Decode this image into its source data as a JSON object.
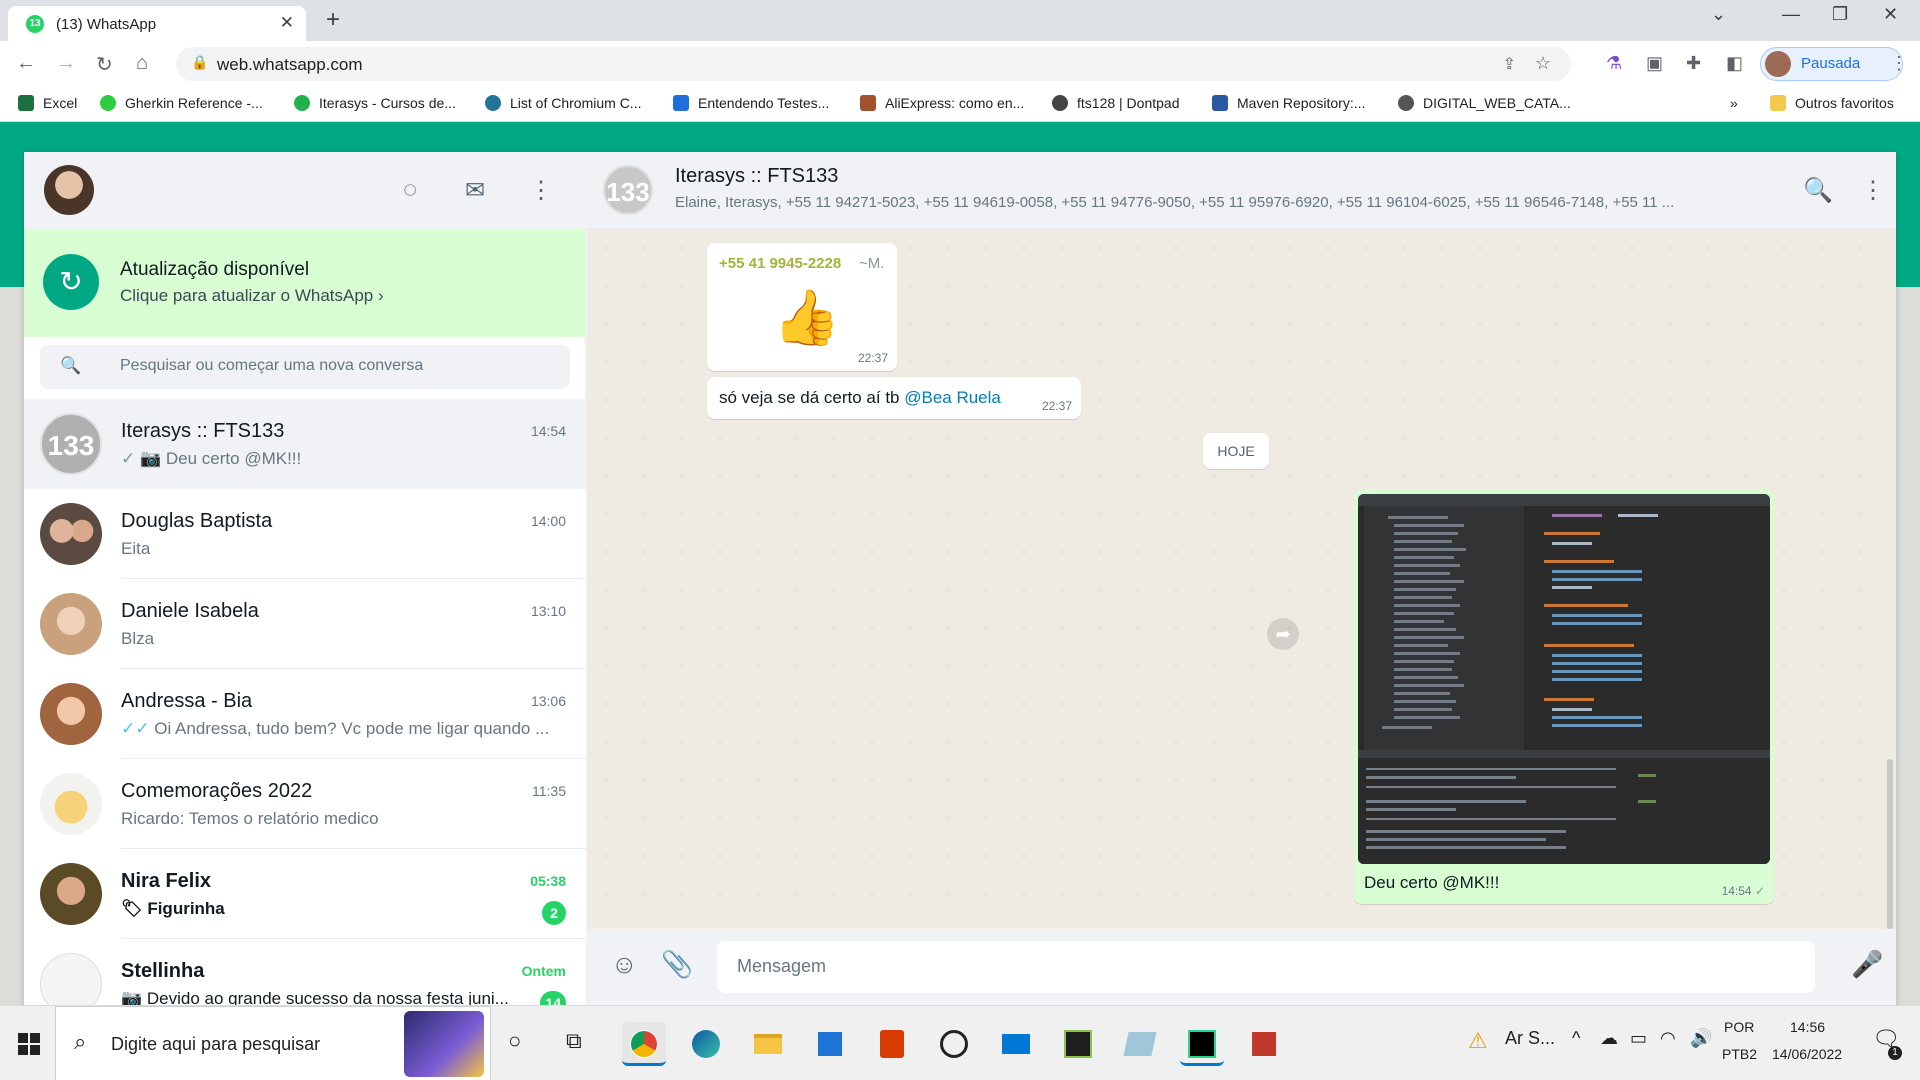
{
  "browser": {
    "tab_title": "(13) WhatsApp",
    "tab_badge": "13",
    "url": "web.whatsapp.com",
    "profile_label": "Pausada",
    "bookmarks": [
      {
        "label": "Excel",
        "color": "#1d6f42"
      },
      {
        "label": "Gherkin Reference -...",
        "color": "#2ecc40"
      },
      {
        "label": "Iterasys - Cursos de...",
        "color": "#22b14c"
      },
      {
        "label": "List of Chromium C...",
        "color": "#21759b"
      },
      {
        "label": "Entendendo Testes...",
        "color": "#1e6fd9"
      },
      {
        "label": "AliExpress: como en...",
        "color": "#a0522d"
      },
      {
        "label": "fts128 | Dontpad",
        "color": "#444444"
      },
      {
        "label": "Maven Repository:...",
        "color": "#2c5aa0"
      },
      {
        "label": "DIGITAL_WEB_CATA...",
        "color": "#555555"
      }
    ],
    "more_bookmarks": "»",
    "other_favorites": "Outros favoritos"
  },
  "update_banner": {
    "title": "Atualização disponível",
    "subtitle": "Clique para atualizar o WhatsApp"
  },
  "search": {
    "placeholder": "Pesquisar ou começar uma nova conversa"
  },
  "chats": [
    {
      "name": "Iterasys :: FTS133",
      "time": "14:54",
      "tick": "✓",
      "tick_color": "grey",
      "msg": "Deu certo @MK!!!",
      "media": "📷",
      "avatar_text": "133",
      "avatar_color": "#b0b0b0",
      "selected": true
    },
    {
      "name": "Douglas Baptista",
      "time": "14:00",
      "msg": "Eita",
      "avatar_color": "#5a4a42"
    },
    {
      "name": "Daniele Isabela",
      "time": "13:10",
      "msg": "Blza",
      "avatar_color": "#d7b9a0"
    },
    {
      "name": "Andressa - Bia",
      "time": "13:06",
      "tick": "✓✓",
      "tick_color": "blue",
      "msg": "Oi Andressa, tudo bem? Vc pode me ligar quando ...",
      "avatar_color": "#c98a6a"
    },
    {
      "name": "Comemorações 2022",
      "time": "11:35",
      "msg": "Ricardo: Temos o relatório medico",
      "avatar_color": "#e8c47a"
    },
    {
      "name": "Nira Felix",
      "time": "05:38",
      "time_green": true,
      "media": "🏷",
      "msg": "Figurinha",
      "badge": "2",
      "avatar_color": "#6b5a3a"
    },
    {
      "name": "Stellinha",
      "time": "Ontem",
      "time_green": true,
      "media": "📷",
      "msg": "Devido ao grande sucesso da nossa festa juni...",
      "badge": "14",
      "avatar_color": "#f4f4f4"
    }
  ],
  "conversation": {
    "name": "Iterasys :: FTS133",
    "avatar_text": "133",
    "members": "Elaine, Iterasys, +55 11 94271-5023, +55 11 94619-0058, +55 11 94776-9050, +55 11 95976-6920, +55 11 96104-6025, +55 11 96546-7148, +55 11 ...",
    "messages": {
      "m1": {
        "sender": "+55 41 9945-2228",
        "tag": "~M.",
        "emoji": "👍",
        "time": "22:37"
      },
      "m2": {
        "text": "só veja se dá certo aí tb ",
        "mention": "@Bea Ruela",
        "time": "22:37"
      },
      "date_divider": "HOJE",
      "m3": {
        "caption": "Deu certo @MK!!!",
        "time": "14:54",
        "tick": "✓"
      }
    },
    "composer_placeholder": "Mensagem"
  },
  "taskbar": {
    "search_placeholder": "Digite aqui para pesquisar",
    "weather": "Ar S...",
    "lang1": "POR",
    "lang2": "PTB2",
    "time": "14:56",
    "date": "14/06/2022",
    "notif": "1"
  },
  "colors": {
    "accent": "#00a884",
    "outgoing": "#d9fdd3",
    "green_badge": "#25d366"
  }
}
